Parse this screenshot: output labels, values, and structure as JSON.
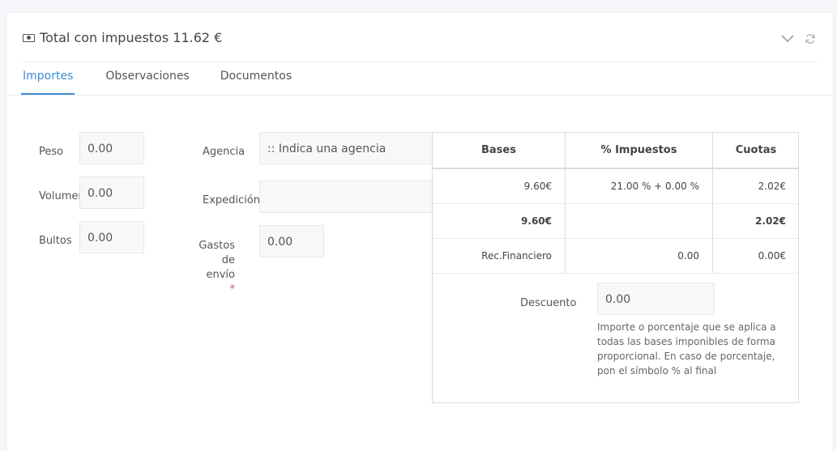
{
  "header": {
    "title": "Total con impuestos 11.62 €",
    "icons": [
      "money-icon",
      "chevron-down-icon",
      "refresh-icon"
    ]
  },
  "tabs": [
    {
      "label": "Importes",
      "active": true
    },
    {
      "label": "Observaciones",
      "active": false
    },
    {
      "label": "Documentos",
      "active": false
    }
  ],
  "form": {
    "peso": {
      "label": "Peso",
      "value": "0.00"
    },
    "volumen": {
      "label": "Volumen",
      "value": "0.00"
    },
    "bultos": {
      "label": "Bultos",
      "value": "0.00"
    },
    "agencia": {
      "label": "Agencia",
      "value": ":: Indica una agencia"
    },
    "expedicion": {
      "label": "Expedición",
      "value": ""
    },
    "gastos": {
      "label_line1": "Gastos",
      "label_line2": "de",
      "label_line3": "envío",
      "required_mark": "*",
      "value": "0.00"
    }
  },
  "taxes": {
    "headers": [
      "Bases",
      "% Impuestos",
      "Cuotas"
    ],
    "rows": [
      {
        "base": "9.60€",
        "pct": "21.00 % + 0.00 %",
        "cuota": "2.02€"
      }
    ],
    "totals": {
      "base": "9.60€",
      "cuota": "2.02€"
    },
    "financiero": {
      "label": "Rec.Financiero",
      "value": "0.00",
      "cuota": "0.00€"
    },
    "descuento": {
      "label": "Descuento",
      "value": "0.00",
      "help": "Importe o porcentaje que se aplica a todas las bases imponibles de forma proporcional. En caso de porcentaje, pon el símbolo % al final"
    }
  },
  "colors": {
    "accent": "#3b8ed6",
    "required": "#d9534f"
  }
}
